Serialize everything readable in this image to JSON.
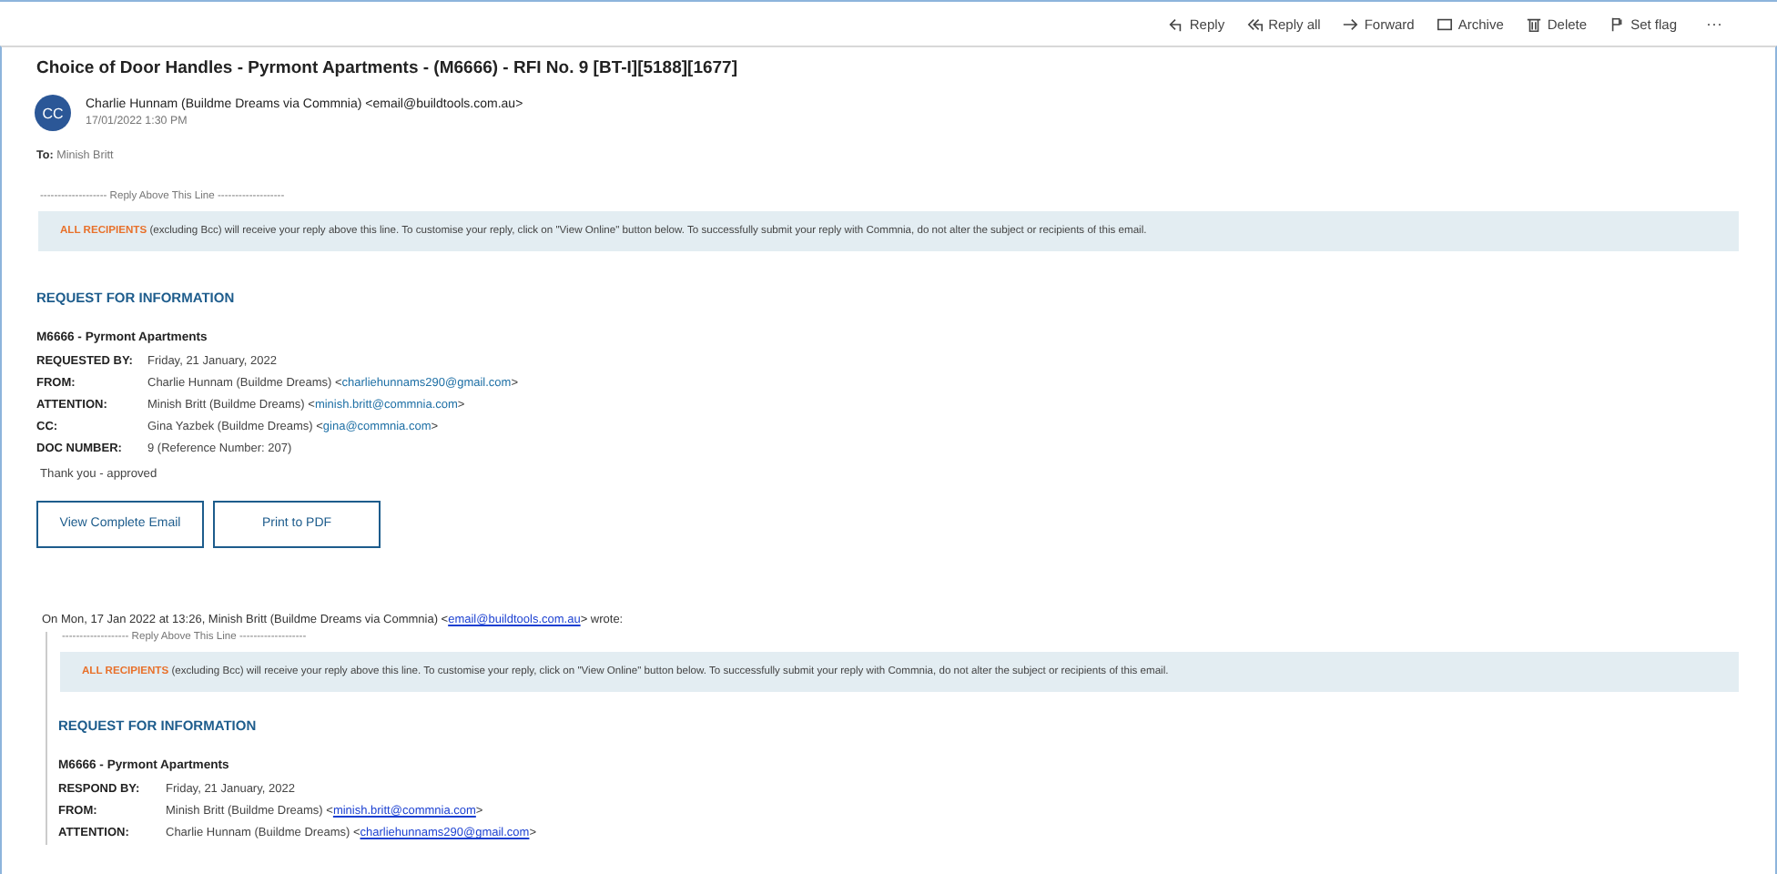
{
  "toolbar": {
    "actions": [
      {
        "kind": "reply",
        "label": "Reply"
      },
      {
        "kind": "reply-all",
        "label": "Reply all"
      },
      {
        "kind": "forward",
        "label": "Forward"
      },
      {
        "kind": "archive",
        "label": "Archive"
      },
      {
        "kind": "delete",
        "label": "Delete"
      },
      {
        "kind": "flag",
        "label": "Set flag"
      }
    ],
    "more": "···"
  },
  "message": {
    "subject": "Choice of Door Handles - Pyrmont Apartments - (M6666) - RFI No. 9 [BT-I][5188][1677]",
    "sender": {
      "initials": "CC",
      "name": "Charlie Hunnam (Buildme Dreams via Commnia)",
      "email": "<email@buildtools.com.au>",
      "date": "17/01/2022 1:30 PM"
    },
    "to": {
      "label": "To:",
      "value": "Minish Britt"
    },
    "body": {
      "reply_line": "------------------- Reply Above This Line -------------------",
      "notice": {
        "highlight": "ALL RECIPIENTS",
        "text": "(excluding Bcc) will receive your reply above this line. To customise your reply, click on \"View Online\" button below. To successfully submit your reply with Commnia, do not alter the subject or recipients of this email."
      },
      "heading": "REQUEST FOR INFORMATION",
      "project": "M6666 - Pyrmont Apartments",
      "fields": [
        {
          "label": "REQUESTED BY:",
          "value": "Friday, 21 January, 2022"
        },
        {
          "label": "FROM:",
          "value": "Charlie Hunnam  (Buildme Dreams)  <",
          "email": "charliehunnams290@gmail.com",
          "after": ">"
        },
        {
          "label": "ATTENTION:",
          "value": "Minish Britt (Buildme Dreams) <",
          "email": "minish.britt@commnia.com",
          "after": ">"
        },
        {
          "label": "CC:",
          "value": "Gina Yazbek (Buildme Dreams) <",
          "email": "gina@commnia.com",
          "after": ">"
        },
        {
          "label": "DOC NUMBER:",
          "value": "9 (Reference Number: 207)"
        }
      ],
      "note": "Thank you - approved",
      "buttons": [
        "View Complete Email",
        "Print to PDF"
      ]
    },
    "quoted": {
      "intro": "On Mon, 17 Jan 2022 at 13:26, Minish Britt (Buildme Dreams via Commnia) <",
      "intro_email": "email@buildtools.com.au",
      "intro_after": "> wrote:",
      "reply_line": "------------------- Reply Above This Line -------------------",
      "notice": {
        "highlight": "ALL RECIPIENTS",
        "text": "(excluding Bcc) will receive your reply above this line. To customise your reply, click on \"View Online\" button below. To successfully submit your reply with Commnia, do not alter the subject or recipients of this email."
      },
      "heading": "REQUEST FOR INFORMATION",
      "project": "M6666 - Pyrmont Apartments",
      "fields": [
        {
          "label": "RESPOND BY:",
          "value": "Friday, 21 January, 2022"
        },
        {
          "label": "FROM:",
          "value": "Minish Britt  (Buildme Dreams)  <",
          "email": "minish.britt@commnia.com",
          "after": ">"
        },
        {
          "label": "ATTENTION:",
          "value": "Charlie Hunnam (Buildme Dreams) <",
          "email": "charliehunnams290@gmail.com",
          "after": ">"
        }
      ]
    }
  }
}
